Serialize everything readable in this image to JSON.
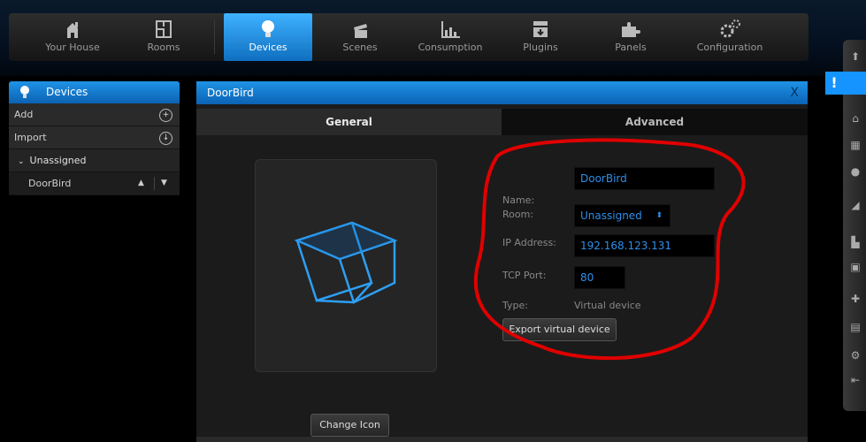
{
  "nav": {
    "items": [
      {
        "label": "Your House",
        "icon": "house-icon"
      },
      {
        "label": "Rooms",
        "icon": "rooms-icon"
      },
      {
        "label": "Devices",
        "icon": "bulb-icon",
        "active": true
      },
      {
        "label": "Scenes",
        "icon": "clapper-icon"
      },
      {
        "label": "Consumption",
        "icon": "chart-icon"
      },
      {
        "label": "Plugins",
        "icon": "plugin-box-icon"
      },
      {
        "label": "Panels",
        "icon": "puzzle-icon"
      },
      {
        "label": "Configuration",
        "icon": "gears-icon"
      }
    ]
  },
  "sidebar": {
    "title": "Devices",
    "add": "Add",
    "import": "Import",
    "category": "Unassigned",
    "device": "DoorBird"
  },
  "dialog": {
    "title": "DoorBird",
    "close": "X",
    "tabs": {
      "general": "General",
      "advanced": "Advanced"
    },
    "change_icon": "Change Icon",
    "form": {
      "name_label": "Name:",
      "name_value": "DoorBird",
      "room_label": "Room:",
      "room_value": "Unassigned",
      "ip_label": "IP Address:",
      "ip_value": "192.168.123.131",
      "port_label": "TCP Port:",
      "port_value": "80",
      "type_label": "Type:",
      "type_value": "Virtual device",
      "export": "Export virtual device"
    }
  },
  "alert": {
    "text": "!"
  },
  "colors": {
    "accent": "#1593ff",
    "annotation": "#e00000"
  }
}
